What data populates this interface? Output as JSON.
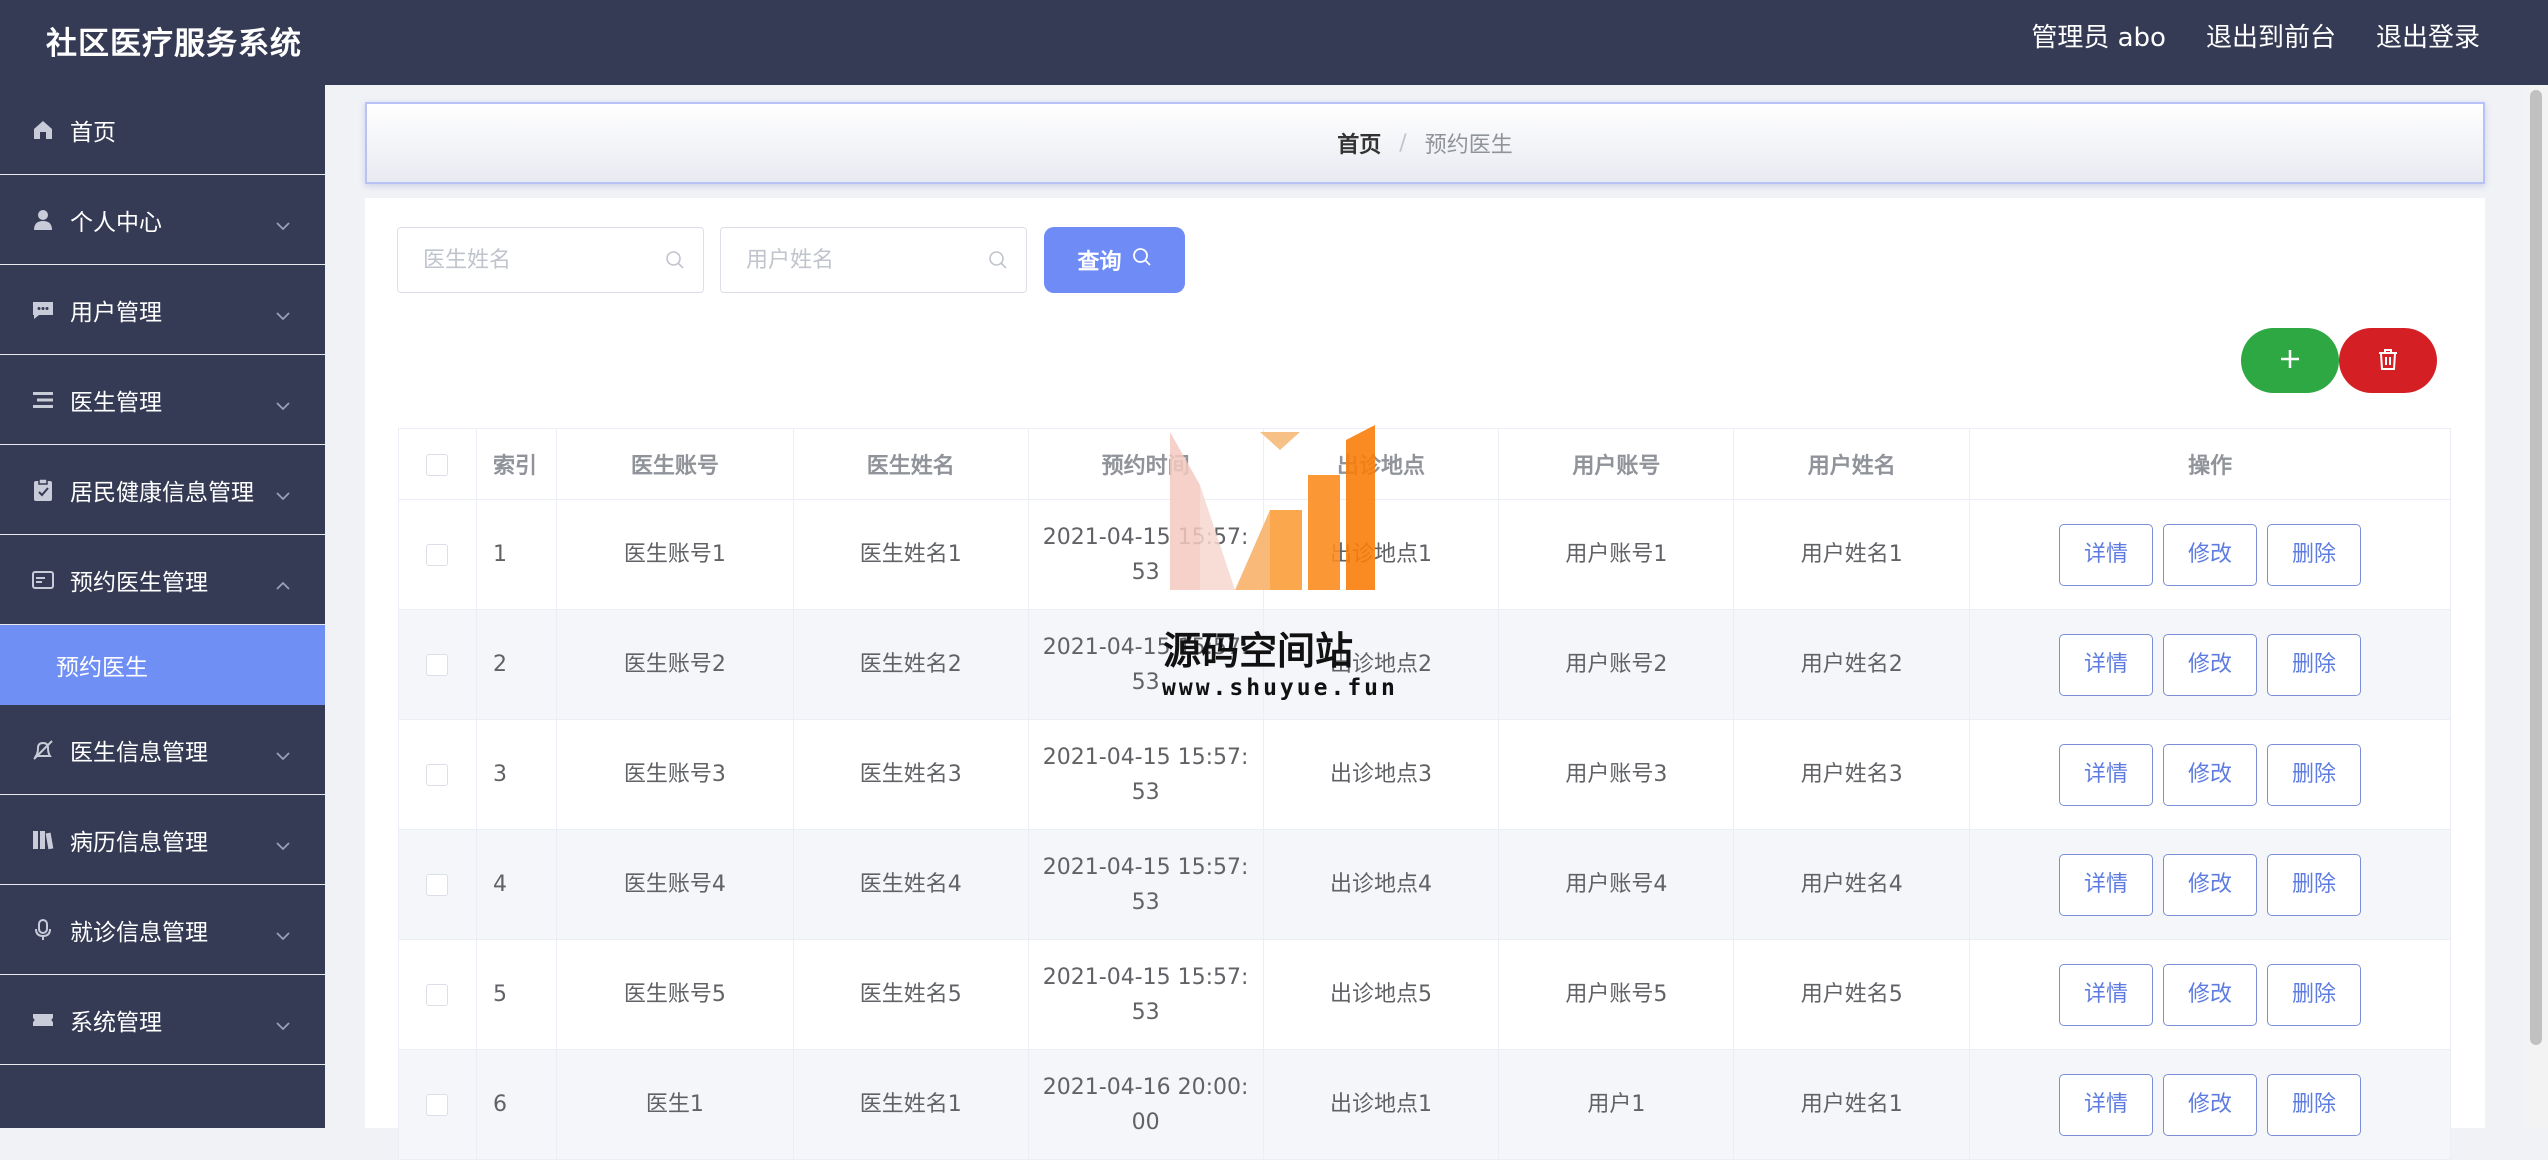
{
  "app": {
    "title": "社区医疗服务系统"
  },
  "header": {
    "user_label": "管理员 abo",
    "frontend_link": "退出到前台",
    "logout_link": "退出登录"
  },
  "sidebar": {
    "items": [
      {
        "label": "首页",
        "icon": "home-icon"
      },
      {
        "label": "个人中心",
        "icon": "user-icon"
      },
      {
        "label": "用户管理",
        "icon": "chat-icon"
      },
      {
        "label": "医生管理",
        "icon": "list-icon"
      },
      {
        "label": "居民健康信息管理",
        "icon": "clipboard-icon"
      },
      {
        "label": "预约医生管理",
        "icon": "card-icon"
      },
      {
        "label": "预约医生",
        "icon": ""
      },
      {
        "label": "医生信息管理",
        "icon": "bell-off-icon"
      },
      {
        "label": "病历信息管理",
        "icon": "books-icon"
      },
      {
        "label": "就诊信息管理",
        "icon": "microphone-icon"
      },
      {
        "label": "系统管理",
        "icon": "ticket-icon"
      }
    ]
  },
  "breadcrumb": {
    "home": "首页",
    "separator": "/",
    "current": "预约医生"
  },
  "search": {
    "doctor_name_placeholder": "医生姓名",
    "user_name_placeholder": "用户姓名",
    "button_label": "查询"
  },
  "table": {
    "headers": [
      "索引",
      "医生账号",
      "医生姓名",
      "预约时间",
      "出诊地点",
      "用户账号",
      "用户姓名",
      "操作"
    ],
    "rows": [
      {
        "index": "1",
        "doctor_account": "医生账号1",
        "doctor_name": "医生姓名1",
        "time_line1": "2021-04-15 15:57:",
        "time_line2": "53",
        "location": "出诊地点1",
        "user_account": "用户账号1",
        "user_name": "用户姓名1"
      },
      {
        "index": "2",
        "doctor_account": "医生账号2",
        "doctor_name": "医生姓名2",
        "time_line1": "2021-04-15 15:57:",
        "time_line2": "53",
        "location": "出诊地点2",
        "user_account": "用户账号2",
        "user_name": "用户姓名2"
      },
      {
        "index": "3",
        "doctor_account": "医生账号3",
        "doctor_name": "医生姓名3",
        "time_line1": "2021-04-15 15:57:",
        "time_line2": "53",
        "location": "出诊地点3",
        "user_account": "用户账号3",
        "user_name": "用户姓名3"
      },
      {
        "index": "4",
        "doctor_account": "医生账号4",
        "doctor_name": "医生姓名4",
        "time_line1": "2021-04-15 15:57:",
        "time_line2": "53",
        "location": "出诊地点4",
        "user_account": "用户账号4",
        "user_name": "用户姓名4"
      },
      {
        "index": "5",
        "doctor_account": "医生账号5",
        "doctor_name": "医生姓名5",
        "time_line1": "2021-04-15 15:57:",
        "time_line2": "53",
        "location": "出诊地点5",
        "user_account": "用户账号5",
        "user_name": "用户姓名5"
      },
      {
        "index": "6",
        "doctor_account": "医生1",
        "doctor_name": "医生姓名1",
        "time_line1": "2021-04-16 20:00:",
        "time_line2": "00",
        "location": "出诊地点1",
        "user_account": "用户1",
        "user_name": "用户姓名1"
      }
    ],
    "actions": {
      "detail": "详情",
      "edit": "修改",
      "delete": "删除"
    }
  },
  "watermark": {
    "title": "源码空间站",
    "url": "www.shuyue.fun"
  },
  "colors": {
    "header_bg": "#363b55",
    "sidebar_bg": "#363b55",
    "active_menu": "#6f8ff5",
    "search_button": "#6e8bf6",
    "add_button": "#2ea843",
    "delete_button": "#d41f24",
    "action_button_text": "#5e7ce0"
  }
}
